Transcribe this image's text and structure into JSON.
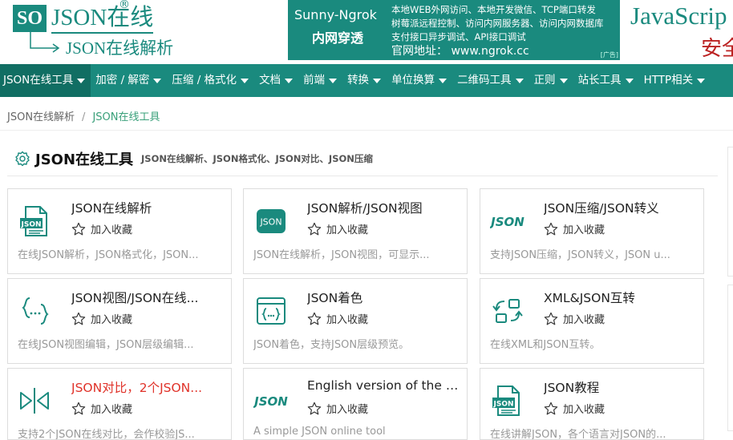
{
  "logo": {
    "badge": "SO",
    "title": "JSON在线",
    "reg": "®",
    "subtitle": "JSON在线解析"
  },
  "ad": {
    "brand": "Sunny-Ngrok",
    "tagline": "内网穿透",
    "lines": [
      "本地WEB外网访问、本地开发微信、TCP端口转发",
      "树莓派远程控制、访问内网服务器、访问内网数据库",
      "支付接口异步调试、API接口调试"
    ],
    "site": "官网地址：  www.ngrok.cc",
    "tag": "[广告]"
  },
  "ad2": {
    "title": "JavaScrip",
    "subtitle": "安全"
  },
  "nav": [
    {
      "label": "JSON在线工具"
    },
    {
      "label": "加密 / 解密"
    },
    {
      "label": "压缩 / 格式化"
    },
    {
      "label": "文档"
    },
    {
      "label": "前端"
    },
    {
      "label": "转换"
    },
    {
      "label": "单位换算"
    },
    {
      "label": "二维码工具"
    },
    {
      "label": "正则"
    },
    {
      "label": "站长工具"
    },
    {
      "label": "HTTP相关"
    }
  ],
  "breadcrumb": {
    "home": "JSON在线解析",
    "separator": "/",
    "current": "JSON在线工具"
  },
  "section": {
    "title": "JSON在线工具",
    "desc": "JSON在线解析、JSON格式化、JSON对比、JSON压缩"
  },
  "fav_label": "加入收藏",
  "cards": [
    {
      "icon": "json-file-icon",
      "title": "JSON在线解析",
      "desc": "在线JSON解析，JSON格式化，JSON..."
    },
    {
      "icon": "json-badge-icon",
      "title": "JSON解析/JSON视图",
      "desc": "JSON在线解析，JSON视图，可显示..."
    },
    {
      "icon": "json-text-icon",
      "title": "JSON压缩/JSON转义",
      "desc": "支持JSON压缩，JSON转义，JSON u..."
    },
    {
      "icon": "curly-braces-icon",
      "title": "JSON视图/JSON在线...",
      "desc": "在线JSON视图编辑，JSON层级编辑..."
    },
    {
      "icon": "code-window-icon",
      "title": "JSON着色",
      "desc": "JSON着色，支持JSON层级预览。"
    },
    {
      "icon": "convert-arrows-icon",
      "title": "XML&JSON互转",
      "desc": "在线XML和JSON互转。"
    },
    {
      "icon": "compare-icon",
      "title": "JSON对比，2个JSON...",
      "desc": "支持2个JSON在线对比，会作校验JS..."
    },
    {
      "icon": "json-text-icon",
      "title": "English version of the J...",
      "desc": "A simple JSON online tool"
    },
    {
      "icon": "json-file-icon",
      "title": "JSON教程",
      "desc": "在线讲解JSON，各个语言对JSON的..."
    }
  ],
  "colors": {
    "brand": "#1a8a7e",
    "nav_active": "#116e63",
    "highlight": "#e0332a",
    "crumb_current": "#3aa07a"
  }
}
